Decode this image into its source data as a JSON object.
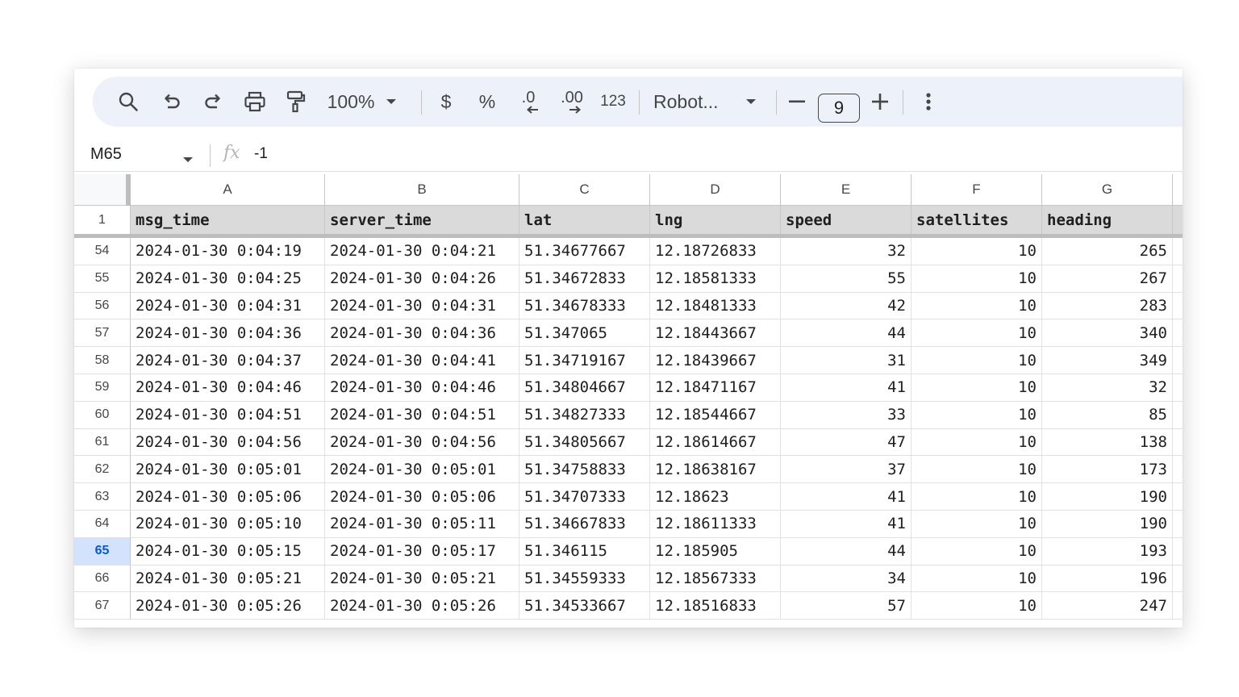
{
  "toolbar": {
    "zoom": "100%",
    "currency_label": "$",
    "percent_label": "%",
    "decrease_decimal_label": ".0",
    "increase_decimal_label": ".00",
    "number_format_label": "123",
    "font_name": "Robot...",
    "font_size": "9",
    "icons": [
      "search-icon",
      "undo-icon",
      "redo-icon",
      "print-icon",
      "paint-format-icon",
      "chevron-down-icon",
      "minus-icon",
      "plus-icon",
      "more-vert-icon"
    ]
  },
  "formula_bar": {
    "cell_ref": "M65",
    "fx_label": "fx",
    "value": "-1"
  },
  "grid": {
    "column_letters": [
      "A",
      "B",
      "C",
      "D",
      "E",
      "F",
      "G"
    ],
    "header_row_number": "1",
    "headers": [
      "msg_time",
      "server_time",
      "lat",
      "lng",
      "speed",
      "satellites",
      "heading"
    ],
    "active_row": "65",
    "rows": [
      {
        "n": "54",
        "cells": [
          "2024-01-30 0:04:19",
          "2024-01-30 0:04:21",
          "51.34677667",
          "12.18726833",
          "32",
          "10",
          "265"
        ]
      },
      {
        "n": "55",
        "cells": [
          "2024-01-30 0:04:25",
          "2024-01-30 0:04:26",
          "51.34672833",
          "12.18581333",
          "55",
          "10",
          "267"
        ]
      },
      {
        "n": "56",
        "cells": [
          "2024-01-30 0:04:31",
          "2024-01-30 0:04:31",
          "51.34678333",
          "12.18481333",
          "42",
          "10",
          "283"
        ]
      },
      {
        "n": "57",
        "cells": [
          "2024-01-30 0:04:36",
          "2024-01-30 0:04:36",
          "51.347065",
          "12.18443667",
          "44",
          "10",
          "340"
        ]
      },
      {
        "n": "58",
        "cells": [
          "2024-01-30 0:04:37",
          "2024-01-30 0:04:41",
          "51.34719167",
          "12.18439667",
          "31",
          "10",
          "349"
        ]
      },
      {
        "n": "59",
        "cells": [
          "2024-01-30 0:04:46",
          "2024-01-30 0:04:46",
          "51.34804667",
          "12.18471167",
          "41",
          "10",
          "32"
        ]
      },
      {
        "n": "60",
        "cells": [
          "2024-01-30 0:04:51",
          "2024-01-30 0:04:51",
          "51.34827333",
          "12.18544667",
          "33",
          "10",
          "85"
        ]
      },
      {
        "n": "61",
        "cells": [
          "2024-01-30 0:04:56",
          "2024-01-30 0:04:56",
          "51.34805667",
          "12.18614667",
          "47",
          "10",
          "138"
        ]
      },
      {
        "n": "62",
        "cells": [
          "2024-01-30 0:05:01",
          "2024-01-30 0:05:01",
          "51.34758833",
          "12.18638167",
          "37",
          "10",
          "173"
        ]
      },
      {
        "n": "63",
        "cells": [
          "2024-01-30 0:05:06",
          "2024-01-30 0:05:06",
          "51.34707333",
          "12.18623",
          "41",
          "10",
          "190"
        ]
      },
      {
        "n": "64",
        "cells": [
          "2024-01-30 0:05:10",
          "2024-01-30 0:05:11",
          "51.34667833",
          "12.18611333",
          "41",
          "10",
          "190"
        ]
      },
      {
        "n": "65",
        "cells": [
          "2024-01-30 0:05:15",
          "2024-01-30 0:05:17",
          "51.346115",
          "12.185905",
          "44",
          "10",
          "193"
        ]
      },
      {
        "n": "66",
        "cells": [
          "2024-01-30 0:05:21",
          "2024-01-30 0:05:21",
          "51.34559333",
          "12.18567333",
          "34",
          "10",
          "196"
        ]
      },
      {
        "n": "67",
        "cells": [
          "2024-01-30 0:05:26",
          "2024-01-30 0:05:26",
          "51.34533667",
          "12.18516833",
          "57",
          "10",
          "247"
        ]
      }
    ]
  }
}
